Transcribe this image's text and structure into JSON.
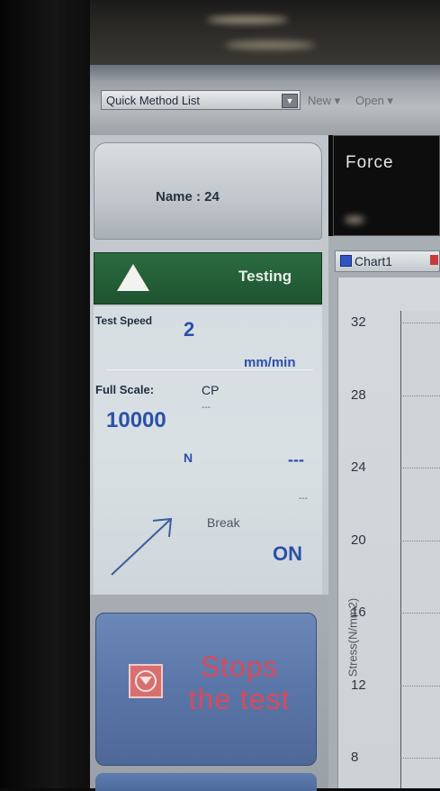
{
  "toolbar": {
    "method_list": "Quick Method List",
    "new_label": "New",
    "open_label": "Open"
  },
  "left_panel": {
    "name": "Name : 24",
    "status": "Testing",
    "test_speed_label": "Test Speed",
    "test_speed_value": "2",
    "speed_unit": "mm/min",
    "full_scale_label": "Full Scale:",
    "cp_label": "CP",
    "cp_value": "---",
    "full_scale_value": "10000",
    "full_scale_unit": "N",
    "force_reading": "---",
    "small_reading": "---",
    "break_label": "Break",
    "break_value": "ON",
    "stop_button_line1": "Stops",
    "stop_button_line2": "the test"
  },
  "force_display": {
    "label": "Force"
  },
  "chart_tab": {
    "label": "Chart1"
  },
  "chart_data": {
    "type": "line",
    "ylabel": "Stress(N/mm2)",
    "y_ticks": [
      32,
      28,
      24,
      20,
      16,
      12,
      8
    ],
    "grid": true,
    "series": []
  },
  "colors": {
    "status_green": "#1e5430",
    "stop_button_blue": "#5a76a8",
    "stop_text_red": "#d84a5a",
    "value_blue": "#2a50a8"
  },
  "icons": {
    "status_icon": "up-triangle-icon",
    "stop_icon": "stop-icon",
    "break_icon": "diagonal-arrow-icon",
    "dropdown_icon": "chevron-down-icon"
  }
}
